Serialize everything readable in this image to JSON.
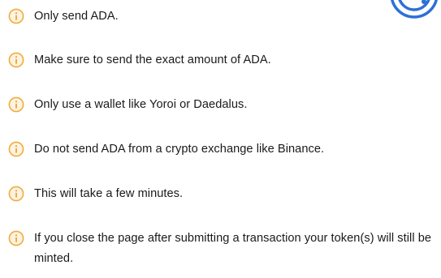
{
  "notices": [
    {
      "text": "Only send ADA.",
      "icon": "info-icon"
    },
    {
      "text": "Make sure to send the exact amount of ADA.",
      "icon": "info-icon"
    },
    {
      "text": "Only use a wallet like Yoroi or Daedalus.",
      "icon": "info-icon"
    },
    {
      "text": "Do not send ADA from a crypto exchange like Binance.",
      "icon": "info-icon"
    },
    {
      "text": "This will take a few minutes.",
      "icon": "info-icon"
    },
    {
      "text": "If you close the page after submitting a transaction your token(s) will still be minted.",
      "icon": "info-icon"
    }
  ],
  "colors": {
    "info_icon": "#f0ac3c",
    "text": "#1a1a1a",
    "logo_ring": "#2f6fd6",
    "background": "#ffffff"
  }
}
